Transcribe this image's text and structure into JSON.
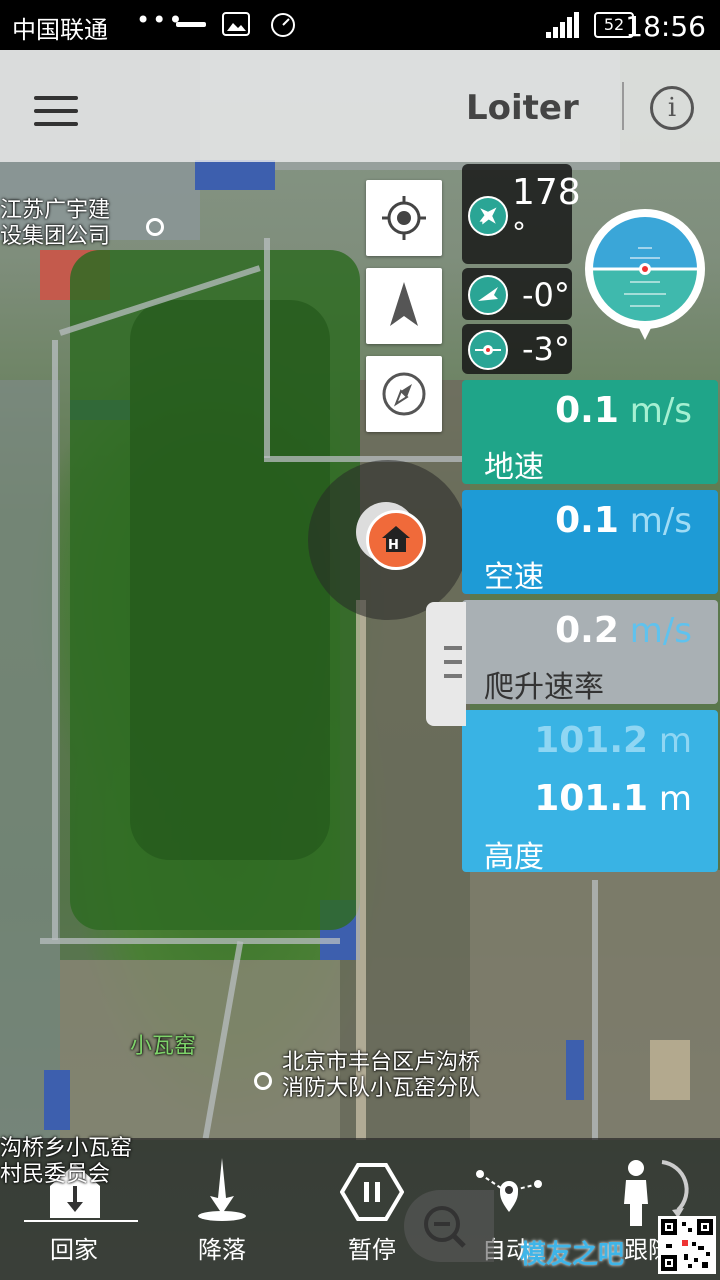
{
  "status_bar": {
    "carrier": "中国联通",
    "dots": "•••",
    "battery": "52",
    "time": "18:56"
  },
  "top_bar": {
    "mode": "Loiter",
    "info_symbol": "i"
  },
  "map": {
    "labels": {
      "company": [
        "江苏广宇建",
        "设集团公司"
      ],
      "village": "小瓦窑",
      "fire_brigade": [
        "北京市丰台区卢沟桥",
        "消防大队小瓦窑分队"
      ],
      "committee": [
        "沟桥乡小瓦窑",
        "村民委员会"
      ]
    },
    "home_marker": "H"
  },
  "telemetry": {
    "heading_value": "178",
    "heading_unit": "°",
    "pitch": "-0°",
    "roll": "-3°"
  },
  "cards": {
    "ground_speed": {
      "value": "0.1",
      "unit": " m/s",
      "label": "地速",
      "color": "#1fa589"
    },
    "air_speed": {
      "value": "0.1",
      "unit": " m/s",
      "label": "空速",
      "color": "#1e9bd6"
    },
    "climb_rate": {
      "value": "0.2",
      "unit": " m/s",
      "label": "爬升速率",
      "color": "#a9b0b4"
    },
    "altitude": {
      "value_1": "101.2",
      "unit_1": " m",
      "value_2": "101.1",
      "unit_2": " m",
      "label": "高度",
      "color": "#39b3e4"
    }
  },
  "bottom_bar": {
    "home": "回家",
    "land": "降落",
    "pause": "暂停",
    "auto": "自动",
    "follow": "跟随"
  },
  "watermark": "模友之吧",
  "icons": [
    "menu-icon",
    "info-icon",
    "locate-icon",
    "navigation-arrow-icon",
    "compass-icon",
    "plane-icon",
    "pitch-icon",
    "roll-icon",
    "attitude-indicator-icon",
    "home-marker-icon",
    "handle-icon",
    "home-arrow-icon",
    "land-icon",
    "pause-icon",
    "waypoint-icon",
    "follow-icon",
    "zoom-out-icon",
    "qr-code-icon"
  ]
}
